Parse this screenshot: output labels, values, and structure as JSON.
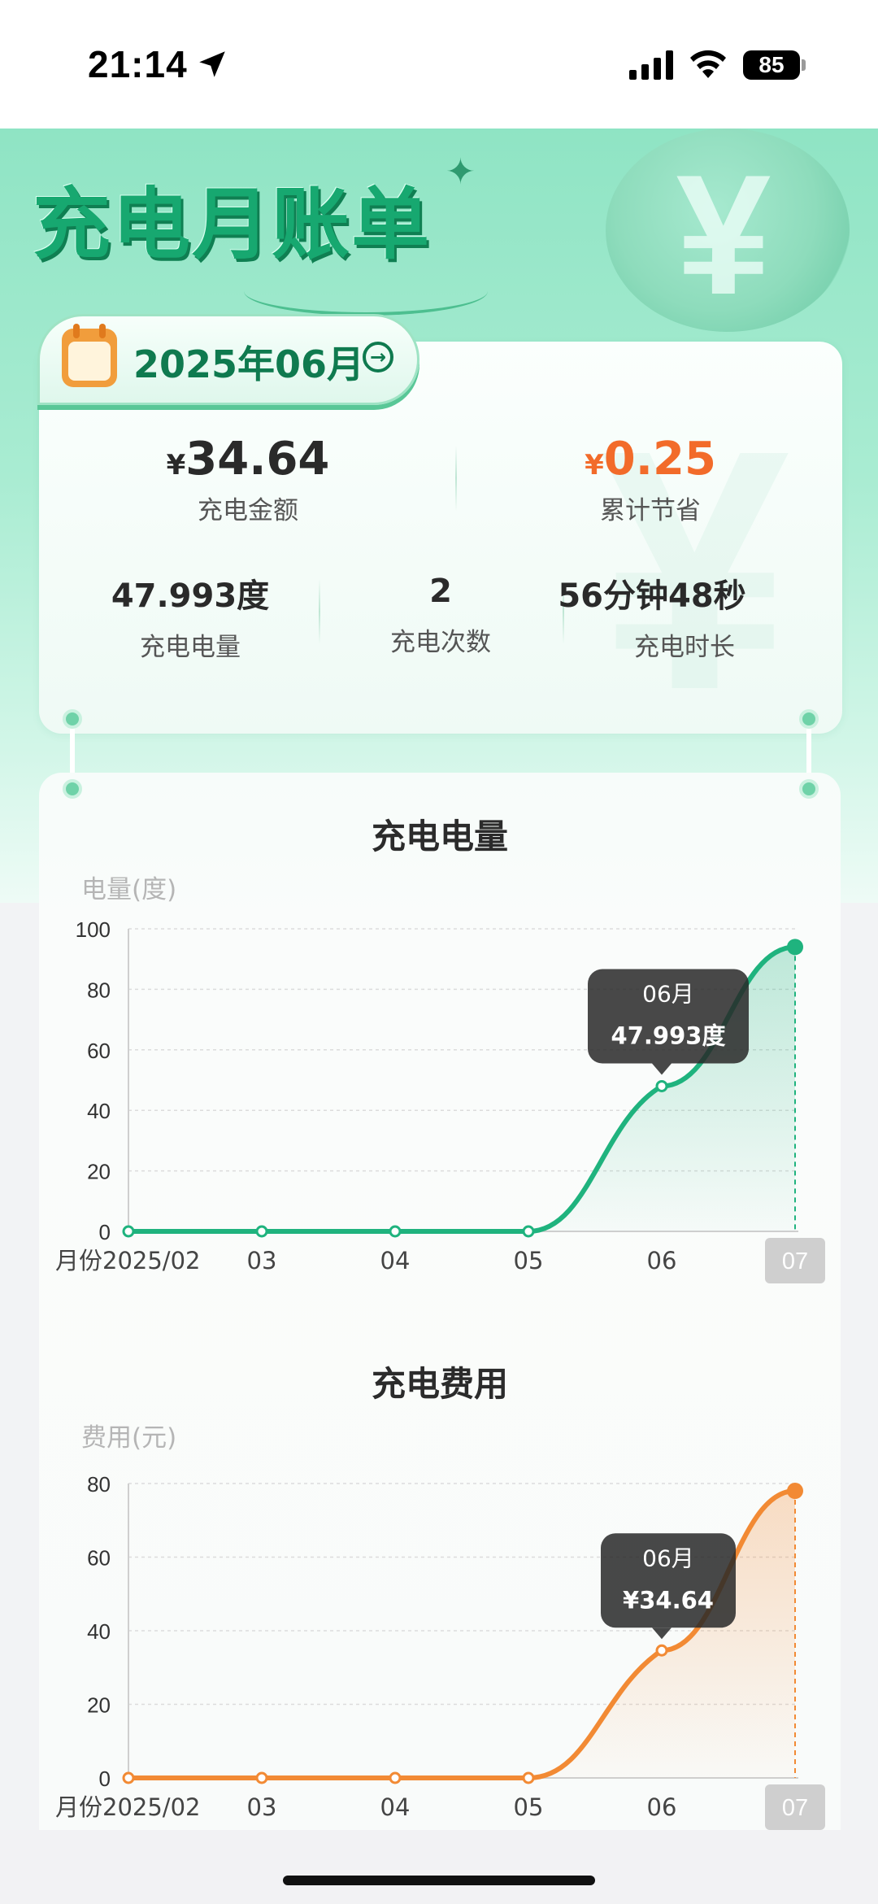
{
  "status_bar": {
    "time": "21:14",
    "battery": "85",
    "icons": [
      "location-arrow-icon",
      "cellular-signal-icon",
      "wifi-icon",
      "battery-icon"
    ]
  },
  "header": {
    "title": "充电月账单"
  },
  "summary": {
    "month": "2025年06月",
    "amount": {
      "currency": "¥",
      "value": "34.64",
      "label": "充电金额"
    },
    "saved": {
      "currency": "¥",
      "value": "0.25",
      "label": "累计节省"
    },
    "energy": {
      "value": "47.993度",
      "label": "充电电量"
    },
    "count": {
      "value": "2",
      "label": "充电次数"
    },
    "duration": {
      "value": "56分钟48秒",
      "label": "充电时长"
    }
  },
  "colors": {
    "energy_line": "#1fb37e",
    "cost_line": "#f28a34",
    "saved_value": "#f26b2a",
    "brand_green": "#0f7a4f"
  },
  "chart_data": [
    {
      "type": "area",
      "title": "充电电量",
      "ylabel": "电量(度)",
      "xlabel_prefix": "月份",
      "categories": [
        "2025/02",
        "03",
        "04",
        "05",
        "06",
        "07"
      ],
      "values": [
        0,
        0,
        0,
        0,
        47.993,
        94
      ],
      "ylim": [
        0,
        100
      ],
      "yticks": [
        0,
        20,
        40,
        60,
        80,
        100
      ],
      "selected_category": "07",
      "tooltip": {
        "title": "06月",
        "value": "47.993度"
      },
      "grid": true
    },
    {
      "type": "area",
      "title": "充电费用",
      "ylabel": "费用(元)",
      "xlabel_prefix": "月份",
      "categories": [
        "2025/02",
        "03",
        "04",
        "05",
        "06",
        "07"
      ],
      "values": [
        0,
        0,
        0,
        0,
        34.64,
        78
      ],
      "ylim": [
        0,
        80
      ],
      "yticks": [
        0,
        20,
        40,
        60,
        80
      ],
      "selected_category": "07",
      "tooltip": {
        "title": "06月",
        "value": "¥34.64"
      },
      "grid": true
    }
  ]
}
